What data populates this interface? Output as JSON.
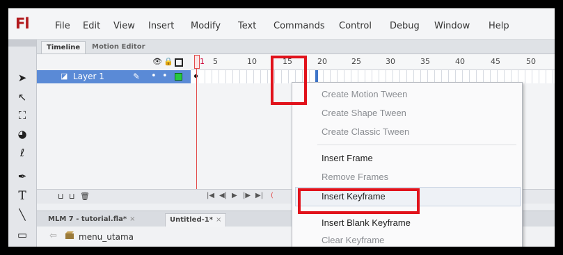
{
  "app": {
    "logo": "Fl"
  },
  "menu": [
    "File",
    "Edit",
    "View",
    "Insert",
    "Modify",
    "Text",
    "Commands",
    "Control",
    "Debug",
    "Window",
    "Help"
  ],
  "panel_tabs": {
    "timeline": "Timeline",
    "motion_editor": "Motion Editor"
  },
  "ruler": {
    "frame_numbers": [
      "1",
      "5",
      "10",
      "15",
      "20",
      "25",
      "30",
      "35",
      "40",
      "45",
      "50"
    ]
  },
  "layer": {
    "name": "Layer 1"
  },
  "context_menu": {
    "items": [
      {
        "label": "Create Motion Tween",
        "enabled": false
      },
      {
        "label": "Create Shape Tween",
        "enabled": false
      },
      {
        "label": "Create Classic Tween",
        "enabled": false
      },
      {
        "label": "Insert Frame",
        "enabled": true
      },
      {
        "label": "Remove Frames",
        "enabled": false
      },
      {
        "label": "Insert Keyframe",
        "enabled": true
      },
      {
        "label": "Insert Blank Keyframe",
        "enabled": true
      },
      {
        "label": "Clear Keyframe",
        "enabled": false
      }
    ]
  },
  "document_tabs": [
    {
      "label": "MLM 7 - tutorial.fla*",
      "close": "×"
    },
    {
      "label": "Untitled-1*",
      "close": "×"
    }
  ],
  "scene": {
    "label": "menu_utama"
  },
  "colors": {
    "highlight": "#e1121b",
    "selected_layer": "#5a8ad6",
    "flash_red": "#b21a1e"
  }
}
